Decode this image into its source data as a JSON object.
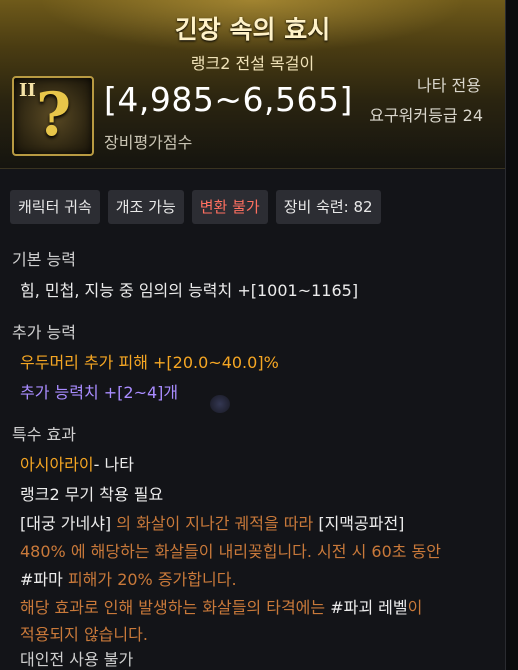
{
  "item": {
    "name": "긴장 속의 효시",
    "subtitle": "랭크2 전설 목걸이",
    "rank_mark": "II",
    "icon_glyph": "?",
    "score": "[4,985~6,565]",
    "score_label": "장비평가점수",
    "class_only": "나타 전용",
    "level_req": "요구워커등급 24"
  },
  "tags": [
    {
      "label": "캐릭터 귀속"
    },
    {
      "label": "개조 가능"
    },
    {
      "label": "변환 불가"
    },
    {
      "label": "장비 숙련: 82"
    }
  ],
  "basic": {
    "title": "기본 능력",
    "line": "힘, 민첩, 지능 중 임의의 능력치 +[1001~1165]"
  },
  "additional": {
    "title": "추가 능력",
    "line1": "우두머리 추가 피해  +[20.0~40.0]%",
    "line2": "추가 능력치 +[2~4]개"
  },
  "special": {
    "title": "특수 효과",
    "set_name": "아시아라이",
    "set_suffix": "- 나타",
    "rank_req": "랭크2 무기 착용 필요",
    "skill_name": "[대궁 가네샤]",
    "desc1_mid": " 의 화살이 지나간 궤적을 따라 ",
    "skill2": "[지맥공파전]",
    "desc2": "480% 에 해당하는 화살들이 내리꽂힙니다. 시전 시 60초 동안",
    "desc3a": "#파마",
    "desc3b": " 피해가 20% 증가합니다.",
    "desc4a": "해당 효과로 인해 발생하는 화살들의 타격에는 ",
    "desc4b": "#파괴 레벨",
    "desc4c": "이",
    "desc5": "적용되지 않습니다.",
    "pvp": "대인전 사용 불가"
  },
  "colors": {
    "header_gold": "#6f5a1a",
    "accent_orange": "#f5a623",
    "accent_purple": "#a98cff",
    "tag_red": "#ff7060"
  }
}
